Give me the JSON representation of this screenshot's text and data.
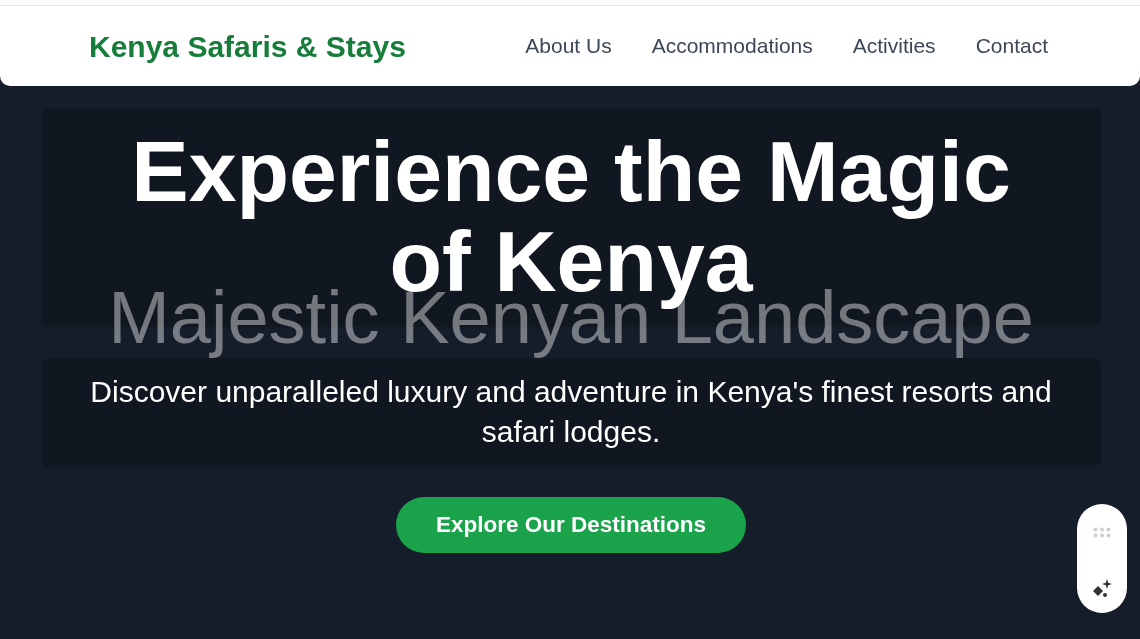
{
  "navbar": {
    "brand": "Kenya Safaris & Stays",
    "links": [
      {
        "label": "About Us"
      },
      {
        "label": "Accommodations"
      },
      {
        "label": "Activities"
      },
      {
        "label": "Contact"
      }
    ]
  },
  "hero": {
    "title": "Experience the Magic of Kenya",
    "image_alt": "Majestic Kenyan Landscape",
    "subtitle": "Discover unparalleled luxury and adventure in Kenya's finest resorts and safari lodges.",
    "button": "Explore Our Destinations"
  }
}
